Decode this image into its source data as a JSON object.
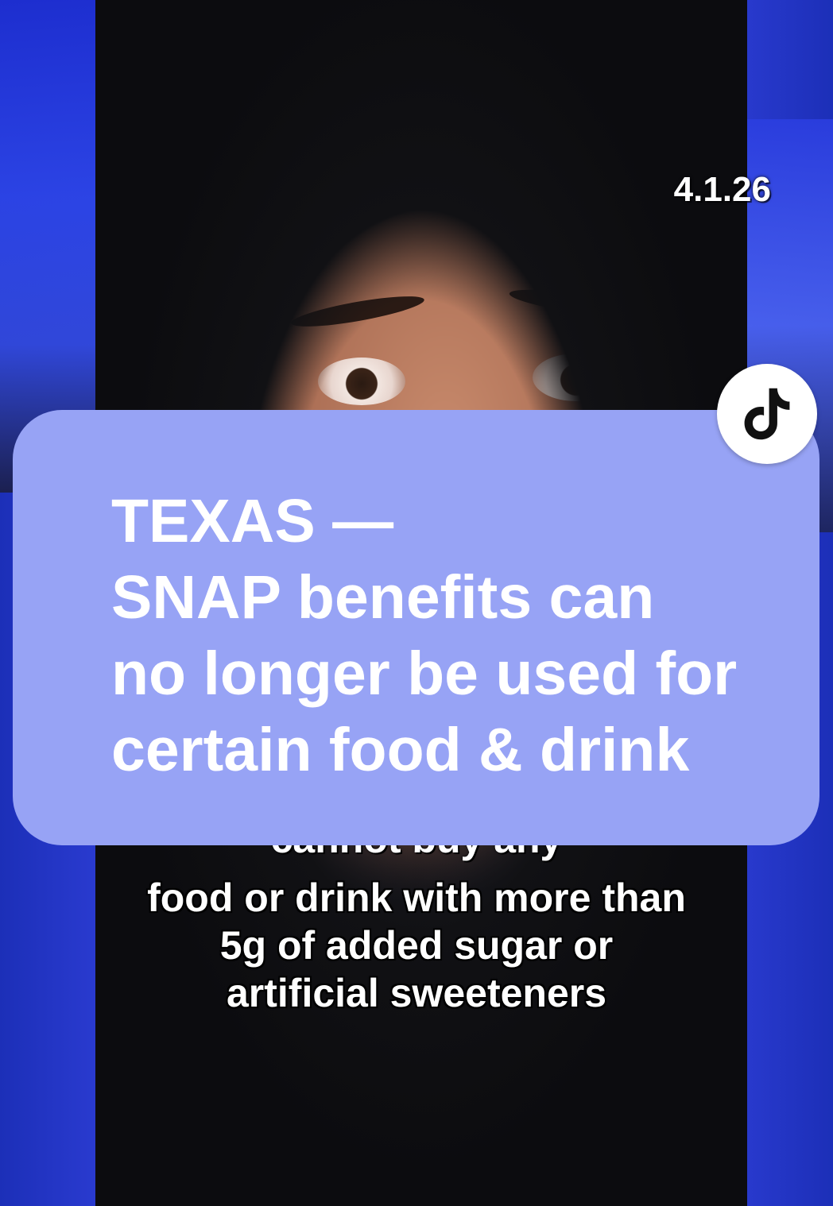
{
  "overlay": {
    "date": "4.1.26"
  },
  "caption": {
    "lines": [
      "TEXAS —",
      "SNAP benefits can",
      "no longer be used for",
      "certain food & drink"
    ],
    "background_color": "#97a3f5"
  },
  "subtitle": {
    "partial_line": "cannot buy any",
    "lines": [
      "food or drink with more than",
      "5g of added sugar or",
      "artificial sweeteners"
    ]
  },
  "badge": {
    "icon": "tiktok-logo-icon"
  }
}
